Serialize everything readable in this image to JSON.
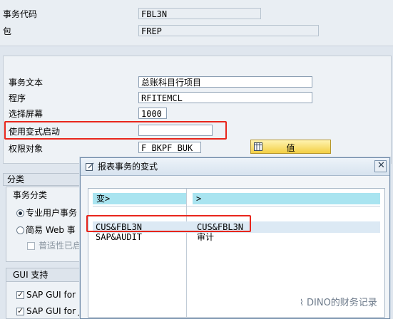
{
  "header_fields": {
    "tcode_label": "事务代码",
    "tcode_value": "FBL3N",
    "package_label": "包",
    "package_value": "FREP"
  },
  "main_fields": {
    "text_label": "事务文本",
    "text_value": "总账科目行项目",
    "program_label": "程序",
    "program_value": "RFITEMCL",
    "screen_label": "选择屏幕",
    "screen_value": "1000",
    "variant_label": "使用变式启动",
    "variant_value": "",
    "auth_label": "权限对象",
    "auth_value": "F_BKPF_BUK",
    "value_button": "值"
  },
  "classification": {
    "section_title": "分类",
    "group_title": "事务分类",
    "option_pro": "专业用户事务",
    "option_web": "简易 Web 事",
    "check_general": "普适性已启",
    "gui_title": "GUI 支持",
    "gui_html": "SAP GUI for H",
    "gui_java": "SAP GUI for Java"
  },
  "dialog": {
    "title": "报表事务的变式",
    "col_variant": "变>",
    "col_text": ">",
    "rows": [
      {
        "variant": "CUS&FBL3N",
        "text": "CUS&FBL3N"
      },
      {
        "variant": "SAP&AUDIT",
        "text": "审计"
      }
    ]
  },
  "watermark": "DINO的财务记录",
  "colors": {
    "highlight_red": "#e8261c",
    "table_header": "#a9e4f0",
    "button_yellow": "#f3cf44"
  }
}
